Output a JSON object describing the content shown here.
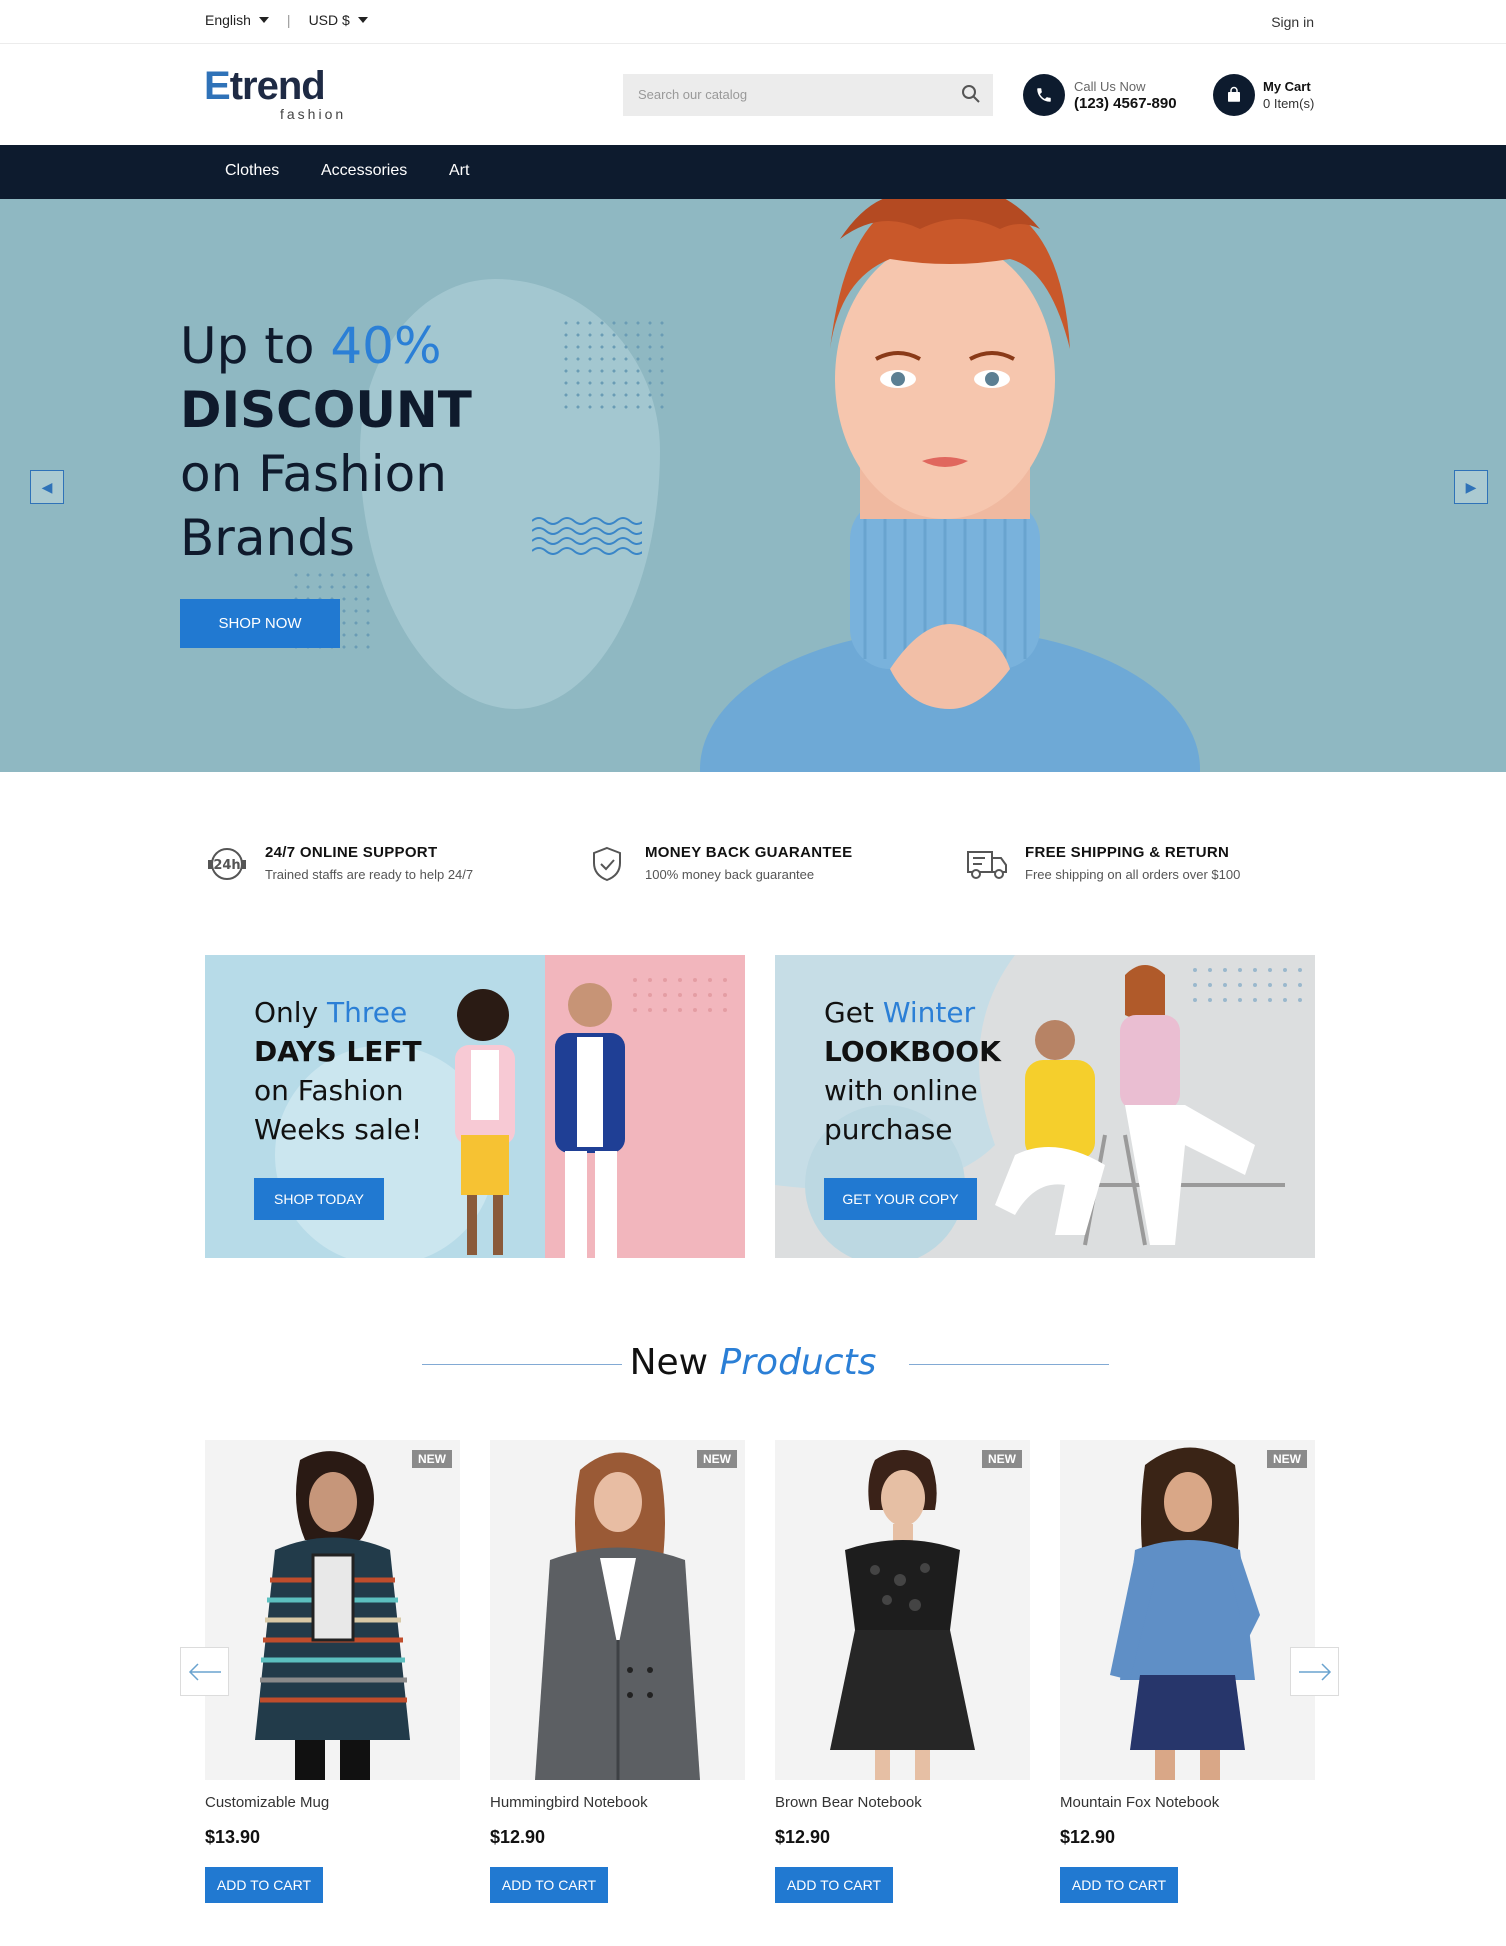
{
  "topbar": {
    "language": "English",
    "currency": "USD $",
    "signin": "Sign in"
  },
  "header": {
    "logo_first": "E",
    "logo_rest": "trend",
    "logo_sub": "fashion",
    "search_placeholder": "Search our catalog",
    "call_label": "Call Us Now",
    "call_number": "(123) 4567-890",
    "cart_label": "My Cart",
    "cart_count": "0 Item(s)"
  },
  "nav": {
    "items": [
      {
        "label": "Clothes"
      },
      {
        "label": "Accessories"
      },
      {
        "label": "Art"
      }
    ]
  },
  "hero": {
    "line1_prefix": "Up to ",
    "line1_highlight": "40%",
    "line2": "DISCOUNT",
    "line3": "on Fashion",
    "line4": "Brands",
    "button": "SHOP NOW"
  },
  "features": [
    {
      "icon": "support-24h-icon",
      "title": "24/7 ONLINE SUPPORT",
      "desc": "Trained staffs are ready to help 24/7"
    },
    {
      "icon": "shield-check-icon",
      "title": "MONEY BACK GUARANTEE",
      "desc": "100% money back guarantee"
    },
    {
      "icon": "truck-icon",
      "title": "FREE SHIPPING & RETURN",
      "desc": "Free shipping on all orders over $100"
    }
  ],
  "banners": [
    {
      "w1": "Only ",
      "hl": "Three",
      "bold": "DAYS LEFT",
      "l3": "on Fashion",
      "l4": "Weeks sale!",
      "button": "SHOP TODAY"
    },
    {
      "w1": "Get ",
      "hl": "Winter",
      "bold": "LOOKBOOK",
      "l3": "with online",
      "l4": "purchase",
      "button": "GET YOUR COPY"
    }
  ],
  "section": {
    "title_plain": "New ",
    "title_highlight": "Products"
  },
  "products": [
    {
      "badge": "NEW",
      "name": "Customizable Mug",
      "price": "$13.90",
      "button": "ADD TO CART"
    },
    {
      "badge": "NEW",
      "name": "Hummingbird Notebook",
      "price": "$12.90",
      "button": "ADD TO CART"
    },
    {
      "badge": "NEW",
      "name": "Brown Bear Notebook",
      "price": "$12.90",
      "button": "ADD TO CART"
    },
    {
      "badge": "NEW",
      "name": "Mountain Fox Notebook",
      "price": "$12.90",
      "button": "ADD TO CART"
    }
  ],
  "colors": {
    "accent": "#2179d1",
    "nav_bg": "#0d1b2e",
    "hero_bg": "#8fb8c2"
  }
}
